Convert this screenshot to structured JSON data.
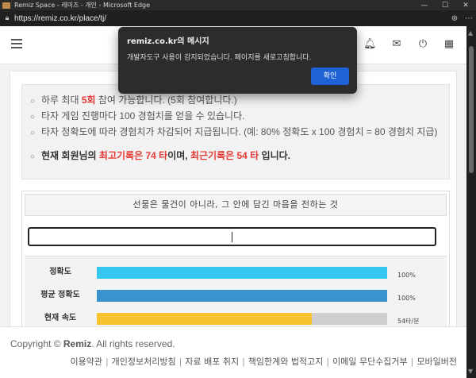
{
  "window": {
    "title": "Remiz Space - 레미즈 - 개인 - Microsoft Edge",
    "controls": [
      "—",
      "☐",
      "✕"
    ]
  },
  "browser": {
    "url": "https://remiz.co.kr/place/tj/",
    "icons": [
      "zoom-icon",
      "more-icon"
    ]
  },
  "navbar": {
    "icons": [
      "bell-icon",
      "mail-icon",
      "power-icon",
      "grid-icon"
    ]
  },
  "info": {
    "line1_prefix": "하루 최대 ",
    "line1_highlight": "5회",
    "line1_suffix": " 참여 가능합니다. (5회 참여합니다.)",
    "line2": "타자 게임 진행마다 100 경험치를 얻을 수 있습니다.",
    "line3": "타자 정확도에 따라 경험치가 차감되어 지급됩니다. (예: 80% 정확도 x 100 경험치 = 80 경험치 지급)",
    "record_prefix": "현재 회원님의 ",
    "record_best": "최고기록은 74 타",
    "record_mid": "이며, ",
    "record_recent": "최근기록은 54 타",
    "record_suffix": " 입니다."
  },
  "game": {
    "sentence": "선물은 물건이 아니라, 그 안에 담긴 마음을 전하는 것",
    "input_value": ""
  },
  "stats": [
    {
      "label": "정확도",
      "value": "100%",
      "fraction": 1.0,
      "color": "#35c7f0"
    },
    {
      "label": "평균 정확도",
      "value": "100%",
      "fraction": 1.0,
      "color": "#3a93cc"
    },
    {
      "label": "현재 속도",
      "value": "54타/분",
      "fraction": 0.74,
      "color": "#f9c32f"
    }
  ],
  "footer": {
    "copyright_prefix": "Copyright © ",
    "copyright_brand": "Remiz",
    "copyright_suffix": ". All rights reserved.",
    "links": [
      "이용약관",
      "개인정보처리방침",
      "자료 배포 취지",
      "책임한계와 법적고지",
      "이메일 무단수집거부",
      "모바일버전"
    ]
  },
  "dialog": {
    "title": "remiz.co.kr의 메시지",
    "message": "개발자도구 사용이 감지되었습니다. 페이지를 새로고침합니다.",
    "confirm_label": "확인"
  }
}
